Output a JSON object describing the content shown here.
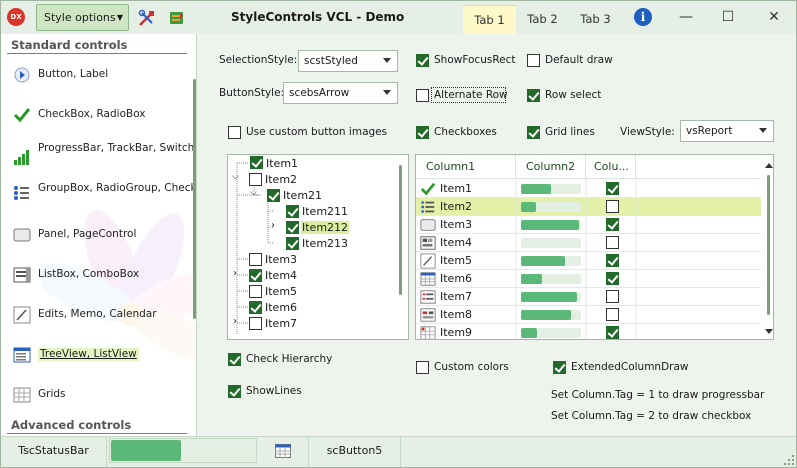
{
  "window": {
    "app_icon_text": "DX",
    "title": "StyleControls VCL - Demo",
    "style_button": "Style options",
    "tabs": [
      "Tab 1",
      "Tab 2",
      "Tab 3"
    ],
    "active_tab": 0,
    "min": "—",
    "max": "☐",
    "close": "✕"
  },
  "sidebar": {
    "section1": "Standard controls",
    "section2": "Advanced controls",
    "items": [
      {
        "label": "Button, Label",
        "icon": "button-icon"
      },
      {
        "label": "CheckBox, RadioBox",
        "icon": "checkmark-icon"
      },
      {
        "label": "ProgressBar, TrackBar, Switch, ActivityIndicator",
        "icon": "bar-chart-icon"
      },
      {
        "label": "GroupBox, RadioGroup, CheckGroup",
        "icon": "group-icon"
      },
      {
        "label": "Panel, PageControl",
        "icon": "panel-icon"
      },
      {
        "label": "ListBox, ComboBox",
        "icon": "listbox-icon"
      },
      {
        "label": "Edits, Memo, Calendar",
        "icon": "edit-icon"
      },
      {
        "label": "TreeView, ListView",
        "icon": "treeview-icon",
        "selected": true
      },
      {
        "label": "Grids",
        "icon": "grid-icon"
      }
    ]
  },
  "options": {
    "selection_style_label": "SelectionStyle:",
    "selection_style_value": "scstStyled",
    "button_style_label": "ButtonStyle:",
    "button_style_value": "scebsArrow",
    "show_focus_rect": "ShowFocusRect",
    "default_draw": "Default draw",
    "alternate_row": "Alternate Row",
    "row_select": "Row select",
    "custom_button_images": "Use custom button images",
    "checkboxes": "Checkboxes",
    "grid_lines": "Grid lines",
    "view_style_label": "ViewStyle:",
    "view_style_value": "vsReport",
    "check_hierarchy": "Check Hierarchy",
    "show_lines": "ShowLines",
    "custom_colors": "Custom colors",
    "extended_column_draw": "ExtendedColumnDraw",
    "note1": "Set Column.Tag = 1 to draw progressbar",
    "note2": "Set Column.Tag = 2 to draw checkbox"
  },
  "tree": {
    "nodes": [
      {
        "text": "Item1",
        "checked": true
      },
      {
        "text": "Item2",
        "checked": false
      },
      {
        "text": "Item21",
        "checked": true
      },
      {
        "text": "Item211",
        "checked": true
      },
      {
        "text": "Item212",
        "checked": true,
        "selected": true
      },
      {
        "text": "Item213",
        "checked": true
      },
      {
        "text": "Item3",
        "checked": false
      },
      {
        "text": "Item4",
        "checked": true
      },
      {
        "text": "Item5",
        "checked": false
      },
      {
        "text": "Item6",
        "checked": true
      },
      {
        "text": "Item7",
        "checked": false
      }
    ]
  },
  "listview": {
    "columns": [
      "Column1",
      "Column2",
      "Colu..."
    ],
    "rows": [
      {
        "text": "Item1",
        "icon": "check-icon",
        "progress": 0.5,
        "checked": true
      },
      {
        "text": "Item2",
        "icon": "list-icon",
        "progress": 0.25,
        "checked": false,
        "selected": true
      },
      {
        "text": "Item3",
        "icon": "panel-icon",
        "progress": 0.97,
        "checked": true
      },
      {
        "text": "Item4",
        "icon": "toolbar-icon",
        "progress": 0.0,
        "checked": false
      },
      {
        "text": "Item5",
        "icon": "edit-icon",
        "progress": 0.73,
        "checked": true
      },
      {
        "text": "Item6",
        "icon": "calendar-icon",
        "progress": 0.35,
        "checked": true
      },
      {
        "text": "Item7",
        "icon": "form-icon",
        "progress": 0.93,
        "checked": false
      },
      {
        "text": "Item8",
        "icon": "form2-icon",
        "progress": 0.83,
        "checked": false
      },
      {
        "text": "Item9",
        "icon": "grid-icon",
        "progress": 0.27,
        "checked": true
      }
    ]
  },
  "statusbar": {
    "label": "TscStatusBar",
    "progress": 0.47,
    "button": "scButton5"
  },
  "colors": {
    "accent": "#5ab878",
    "selection": "#e3f0a8",
    "check": "#226a2a"
  }
}
